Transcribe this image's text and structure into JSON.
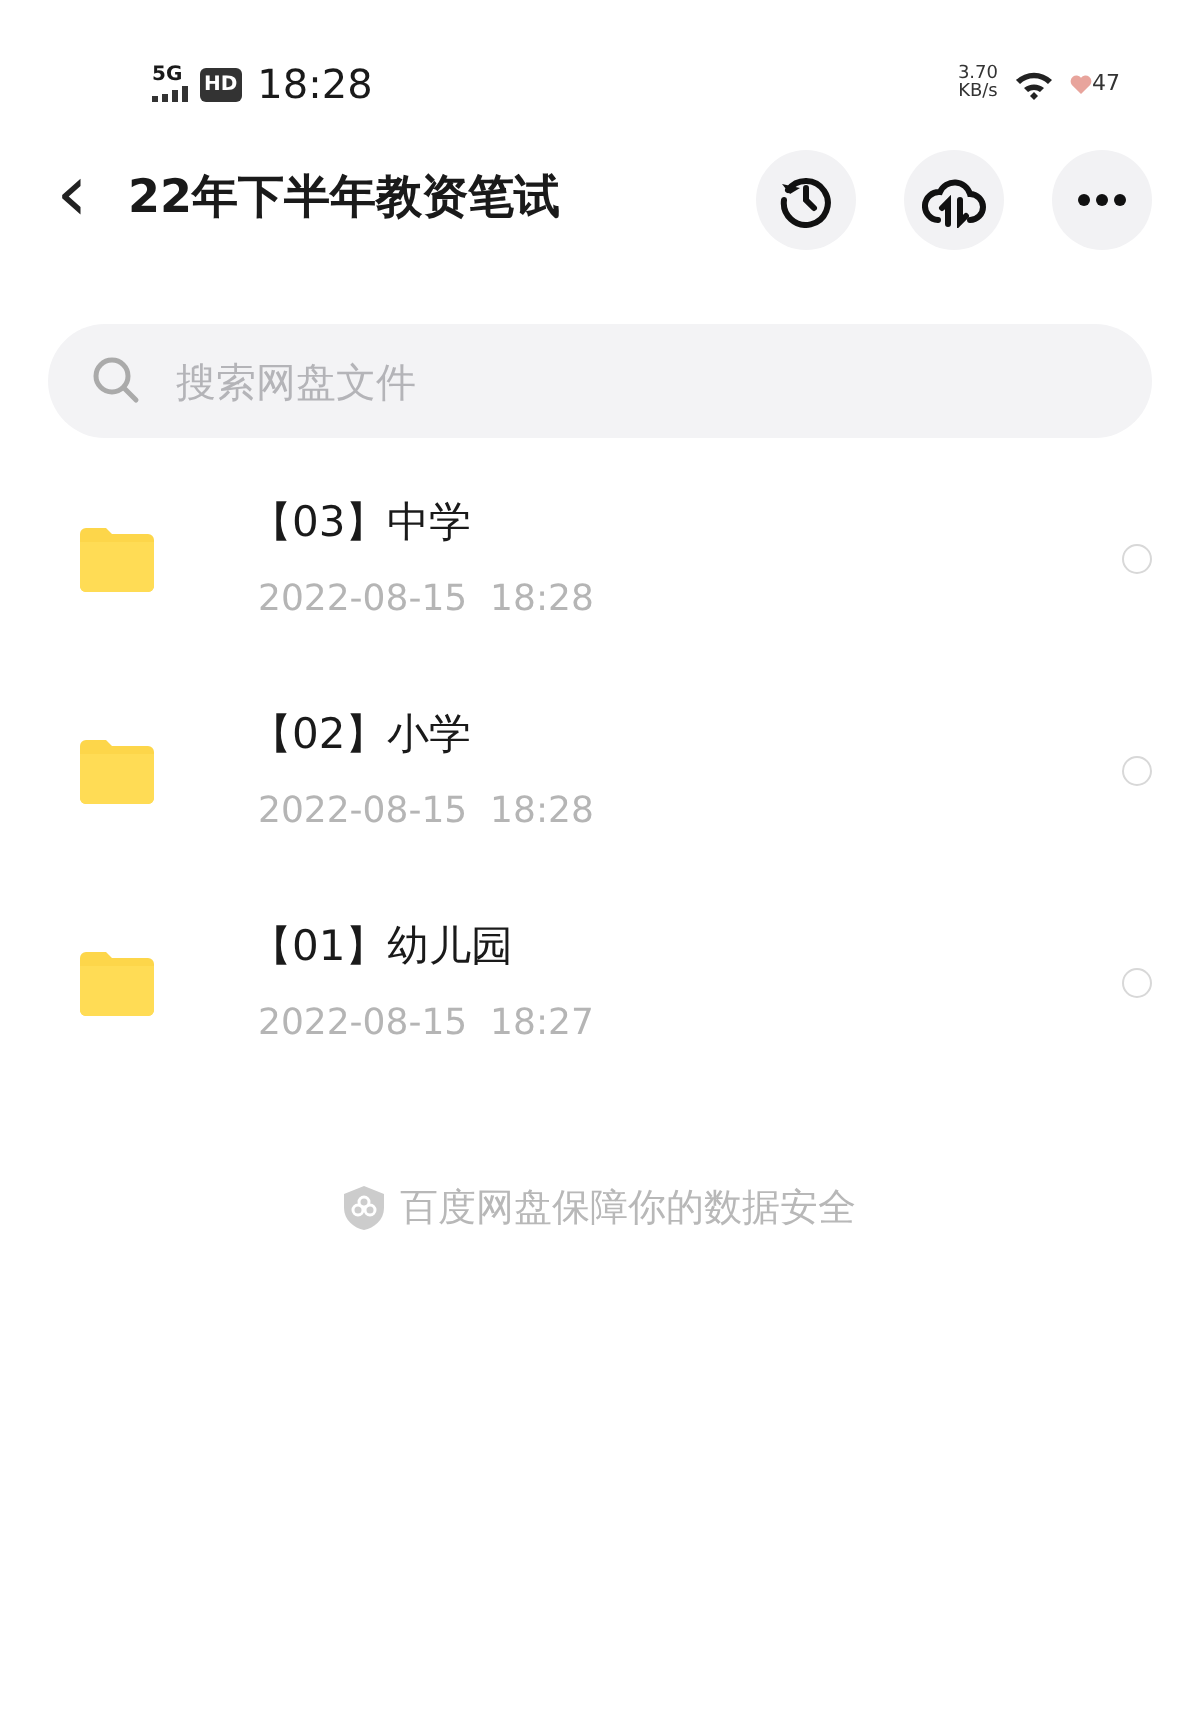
{
  "status_bar": {
    "network": "5G",
    "hd": "HD",
    "time": "18:28",
    "speed": "3.70",
    "speed_unit": "KB/s",
    "battery": "47"
  },
  "header": {
    "back": "‹",
    "title": "22年下半年教资笔试"
  },
  "search": {
    "placeholder": "搜索网盘文件"
  },
  "files": [
    {
      "name": "【03】中学",
      "date": "2022-08-15  18:28",
      "selected": false
    },
    {
      "name": "【02】小学",
      "date": "2022-08-15  18:28",
      "selected": false
    },
    {
      "name": "【01】幼儿园",
      "date": "2022-08-15  18:27",
      "selected": false
    }
  ],
  "footer": "百度网盘保障你的数据安全"
}
